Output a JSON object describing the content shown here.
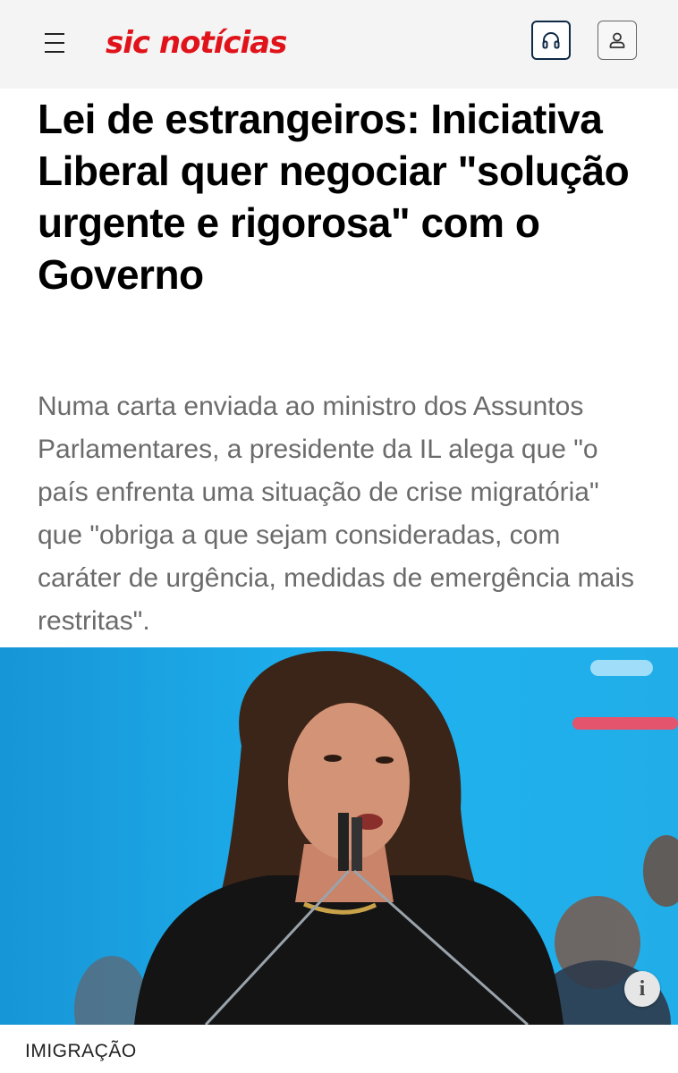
{
  "header": {
    "logo_text": "sic notícias",
    "menu_icon": "hamburger-menu-icon",
    "audio_icon": "headphones-icon",
    "user_icon": "user-icon",
    "brand_color": "#e0131b",
    "background_color": "#f4f4f4"
  },
  "article": {
    "headline": "Lei de estrangeiros: Iniciativa Liberal quer negociar \"solução urgente e rigorosa\" com o Governo",
    "lead": "Numa carta enviada ao ministro dos Assuntos Parlamentares, a presidente da IL alega que \"o país enfrenta uma situação de crise migratória\" que \"obriga a que sejam consideradas, com caráter de urgência, medidas de emergência mais restritas\".",
    "category": "IMIGRAÇÃO",
    "image_info_label": "i",
    "image_info_icon": "info-icon"
  }
}
